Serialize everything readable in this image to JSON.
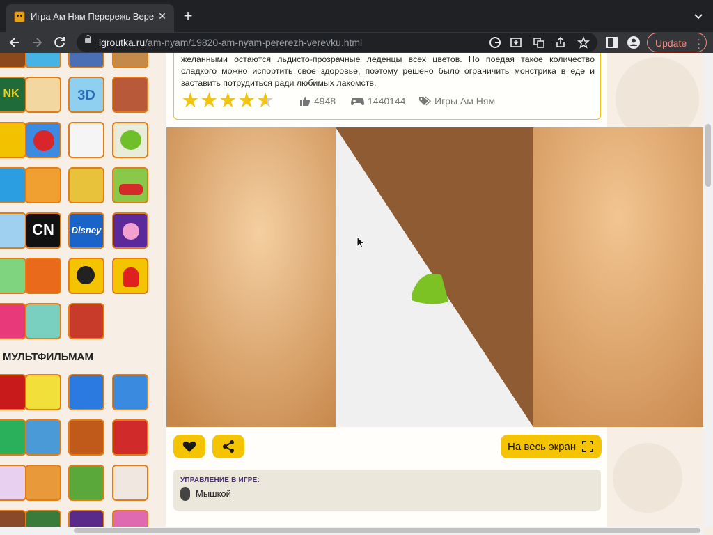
{
  "browser": {
    "tab_title": "Игра Ам Ням Перережь Вере",
    "url_host": "igroutka.ru",
    "url_path": "/am-nyam/19820-am-nyam-pererezh-verevku.html",
    "update_label": "Update"
  },
  "description": {
    "text": "желанными остаются льдисто-прозрачные леденцы всех цветов. Но поедая такое количество сладкого можно испортить свое здоровье, поэтому решено было ограничить монстрика в еде и заставить потрудиться ради любимых лакомств.",
    "rating": 4.5,
    "likes": "4948",
    "plays": "1440144",
    "tag": "Игры Ам Ням"
  },
  "sidebar": {
    "thumb_texts": [
      "NK",
      "CN",
      "Disney"
    ],
    "section_title": "МУЛЬТФИЛЬМАМ"
  },
  "actions": {
    "fullscreen_label": "На весь экран"
  },
  "controls_help": {
    "title": "УПРАВЛЕНИЕ В ИГРЕ:",
    "mouse_label": "Мышкой"
  },
  "colors": {
    "accent_yellow": "#f5c400",
    "thumb_border": "#e77b12",
    "update_red": "#f28b82"
  }
}
